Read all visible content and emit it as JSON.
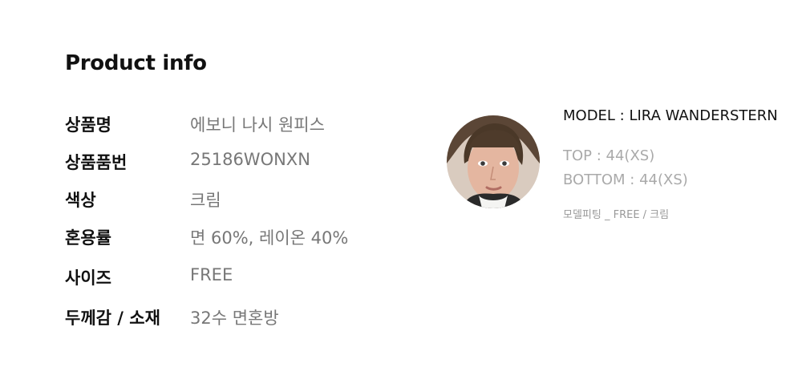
{
  "title": "Product info",
  "details": [
    {
      "label": "상품명",
      "value": "에보니 나시 원피스"
    },
    {
      "label": "상품품번",
      "value": "25186WONXN"
    },
    {
      "label": "색상",
      "value": "크림"
    },
    {
      "label": "혼용률",
      "value": "면 60%, 레이온 40%"
    },
    {
      "label": "사이즈",
      "value": "FREE"
    },
    {
      "label": "두께감 / 소재",
      "value": "32수 면혼방"
    }
  ],
  "model": {
    "name": "MODEL :  LIRA WANDERSTERN",
    "top": "TOP : 44(XS)",
    "bottom": "BOTTOM : 44(XS)",
    "fitting": "모델피팅  _ FREE / 크림",
    "photo_icon": "model-portrait"
  }
}
